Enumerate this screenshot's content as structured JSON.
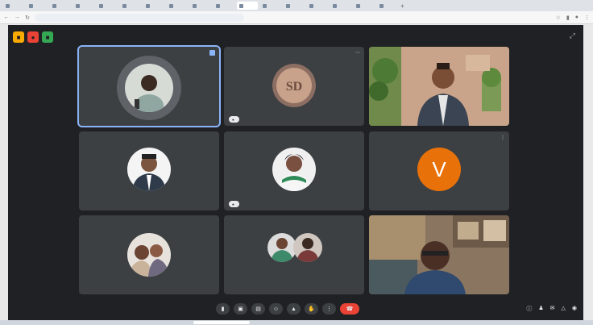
{
  "browser": {
    "tabs": [
      "",
      "",
      "",
      "",
      "",
      "",
      "",
      "",
      "",
      "",
      "",
      "",
      "",
      "",
      "",
      "",
      ""
    ],
    "active_tab": 10,
    "url": ""
  },
  "meet": {
    "top_icon_colors": [
      "#f9ab00",
      "#ea4335",
      "#34a853"
    ],
    "participants": [
      {
        "name": "",
        "kind": "avatar",
        "speaking": true
      },
      {
        "name": "",
        "kind": "initials-avatar",
        "initials": "SD",
        "pill": true
      },
      {
        "name": "",
        "kind": "video"
      },
      {
        "name": "",
        "kind": "avatar"
      },
      {
        "name": "",
        "kind": "avatar",
        "pill": true
      },
      {
        "name": "",
        "kind": "letter",
        "letter": "V",
        "color": "#e8710a"
      },
      {
        "name": "",
        "kind": "avatar"
      },
      {
        "name": "",
        "kind": "avatar-pair"
      },
      {
        "name": "",
        "kind": "video"
      }
    ],
    "clock": "",
    "controls": [
      "mic-icon",
      "camera-icon",
      "captions-icon",
      "emoji-icon",
      "present-icon",
      "hand-icon",
      "more-icon",
      "end-call-icon"
    ],
    "right_icons": [
      "info-icon",
      "people-icon",
      "chat-icon",
      "activities-icon",
      "lock-icon"
    ]
  }
}
